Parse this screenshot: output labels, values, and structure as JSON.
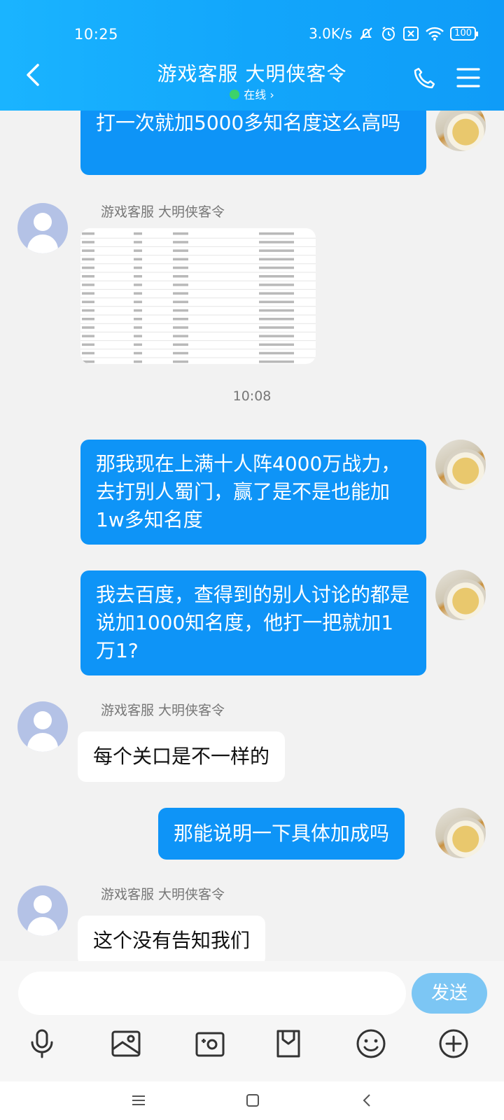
{
  "status_bar": {
    "time": "10:25",
    "net_speed": "3.0K/s",
    "battery": "100"
  },
  "header": {
    "title": "游戏客服 大明侠客令",
    "presence": "在线",
    "presence_color": "#3cd26a",
    "background": "#12a6fb"
  },
  "messages": {
    "m1_text": "打一次就加5000多知名度这么高吗",
    "m2_sender": "游戏客服 大明侠客令",
    "timestamp": "10:08",
    "m3_text": "那我现在上满十人阵4000万战力，去打别人蜀门，赢了是不是也能加1w多知名度",
    "m4_text": "我去百度，查得到的别人讨论的都是说加1000知名度，他打一把就加1万1?",
    "m5_sender": "游戏客服 大明侠客令",
    "m5_text": "每个关口是不一样的",
    "m6_text": "那能说明一下具体加成吗",
    "m7_sender": "游戏客服 大明侠客令",
    "m7_text": "这个没有告知我们"
  },
  "input": {
    "placeholder": "",
    "send_label": "发送"
  },
  "toolbar_icons": [
    "microphone-icon",
    "photo-icon",
    "camera-icon",
    "file-icon",
    "emoji-icon",
    "plus-icon"
  ],
  "colors": {
    "outgoing_bubble": "#0e94f7",
    "incoming_bubble": "#ffffff",
    "send_button": "#7cc6f4"
  }
}
